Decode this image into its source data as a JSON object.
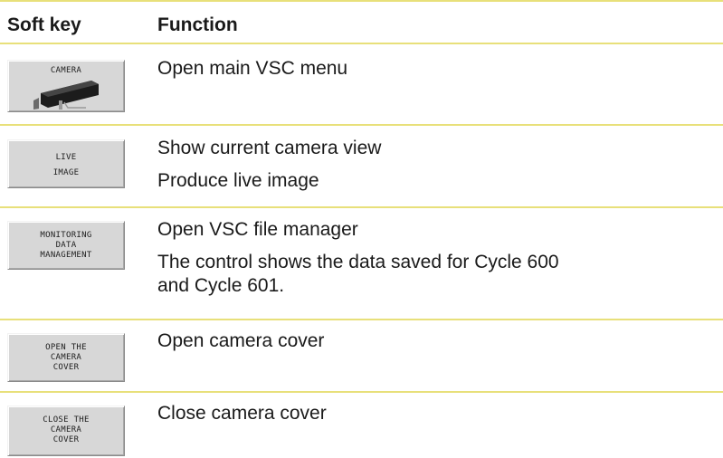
{
  "table": {
    "headers": {
      "softkey": "Soft key",
      "function": "Function"
    },
    "rows": [
      {
        "softkey_lines": [
          "CAMERA"
        ],
        "softkey_icon": "camera-icon",
        "function_lines": [
          "Open main VSC menu"
        ]
      },
      {
        "softkey_lines": [
          "LIVE",
          "IMAGE"
        ],
        "function_lines": [
          "Show current camera view",
          "Produce live image"
        ]
      },
      {
        "softkey_lines": [
          "MONITORING",
          "DATA",
          "MANAGEMENT"
        ],
        "function_lines": [
          "Open VSC file manager",
          "The control shows the data saved for Cycle 600",
          "and Cycle 601."
        ]
      },
      {
        "softkey_lines": [
          "OPEN THE",
          "CAMERA",
          "COVER"
        ],
        "function_lines": [
          "Open camera cover"
        ]
      },
      {
        "softkey_lines": [
          "CLOSE THE",
          "CAMERA",
          "COVER"
        ],
        "function_lines": [
          "Close camera cover"
        ]
      }
    ]
  },
  "colors": {
    "rule": "#e8e07a",
    "softkey_bg": "#d7d7d7"
  }
}
